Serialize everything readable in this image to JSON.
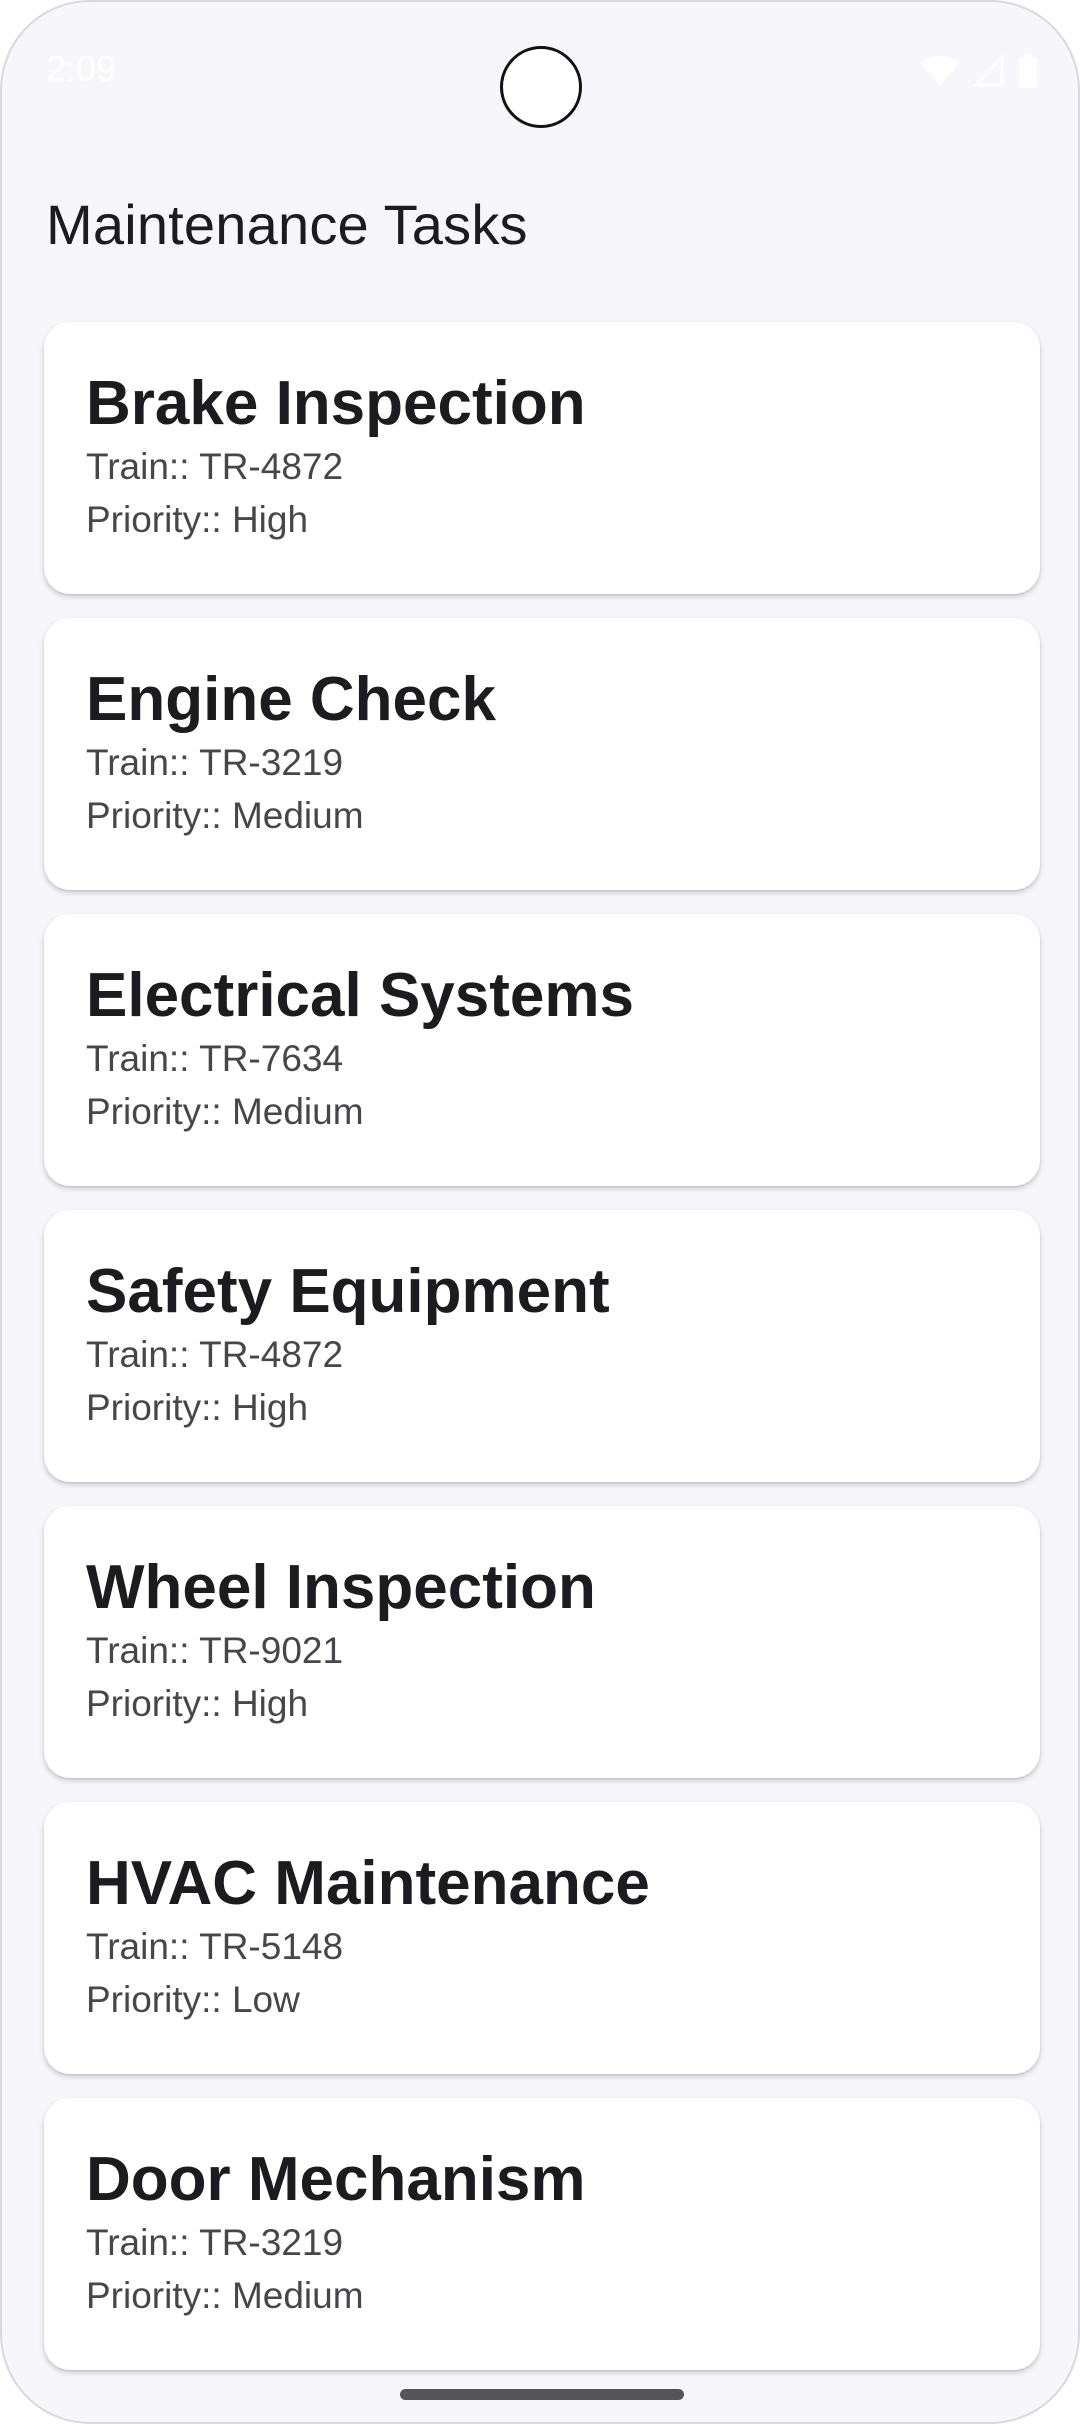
{
  "status_bar": {
    "time": "2:09"
  },
  "page": {
    "title": "Maintenance Tasks"
  },
  "tasks": [
    {
      "title": "Brake Inspection",
      "train": "Train:: TR-4872",
      "priority": "Priority:: High"
    },
    {
      "title": "Engine Check",
      "train": "Train:: TR-3219",
      "priority": "Priority:: Medium"
    },
    {
      "title": "Electrical Systems",
      "train": "Train:: TR-7634",
      "priority": "Priority:: Medium"
    },
    {
      "title": "Safety Equipment",
      "train": "Train:: TR-4872",
      "priority": "Priority:: High"
    },
    {
      "title": "Wheel Inspection",
      "train": "Train:: TR-9021",
      "priority": "Priority:: High"
    },
    {
      "title": "HVAC Maintenance",
      "train": "Train:: TR-5148",
      "priority": "Priority:: Low"
    },
    {
      "title": "Door Mechanism",
      "train": "Train:: TR-3219",
      "priority": "Priority:: Medium"
    }
  ],
  "icons": {
    "wifi": "wifi-icon",
    "signal": "signal-icon",
    "battery": "battery-icon"
  },
  "colors": {
    "background": "#f7f6fb",
    "card": "#ffffff",
    "title_text": "#1c1b1f",
    "secondary_text": "#48464c"
  }
}
